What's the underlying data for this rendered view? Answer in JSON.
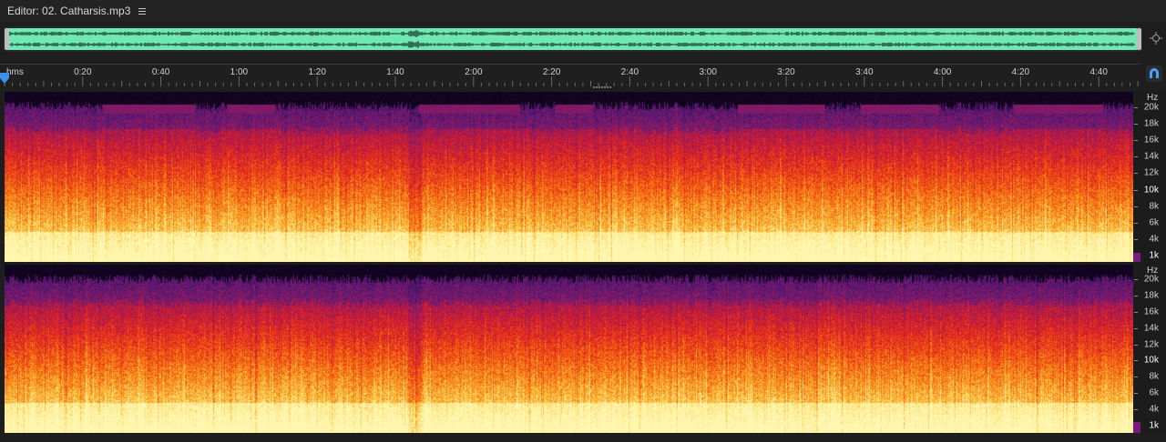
{
  "editor": {
    "title": "Editor: 02. Catharsis.mp3",
    "menu_icon": "hamburger-menu-icon"
  },
  "overview": {
    "waveform_color": "#6fe8b4",
    "waveform_dark": "#1a3a2e"
  },
  "ruler": {
    "unit": "hms",
    "ticks": [
      "0:20",
      "0:40",
      "1:00",
      "1:20",
      "1:40",
      "2:00",
      "2:20",
      "2:40",
      "3:00",
      "3:20",
      "3:40",
      "4:00",
      "4:20",
      "4:40"
    ]
  },
  "frequency_scale": {
    "unit": "Hz",
    "labels": [
      {
        "text": "20k",
        "bold": false
      },
      {
        "text": "18k",
        "bold": false
      },
      {
        "text": "16k",
        "bold": false
      },
      {
        "text": "14k",
        "bold": false
      },
      {
        "text": "12k",
        "bold": false
      },
      {
        "text": "10k",
        "bold": true
      },
      {
        "text": "8k",
        "bold": false
      },
      {
        "text": "6k",
        "bold": false
      },
      {
        "text": "4k",
        "bold": false
      },
      {
        "text": "1k",
        "bold": true
      }
    ]
  },
  "spectrogram": {
    "palette": [
      "#050208",
      "#2a0a4a",
      "#5a1a7a",
      "#9a1a5a",
      "#d81a2a",
      "#f04a10",
      "#f8901a",
      "#fcd050",
      "#fff6b0"
    ]
  },
  "icons": {
    "zoom": "zoom-to-fit-icon",
    "snap": "magnet-snap-icon",
    "playhead": "playhead-marker-icon"
  }
}
